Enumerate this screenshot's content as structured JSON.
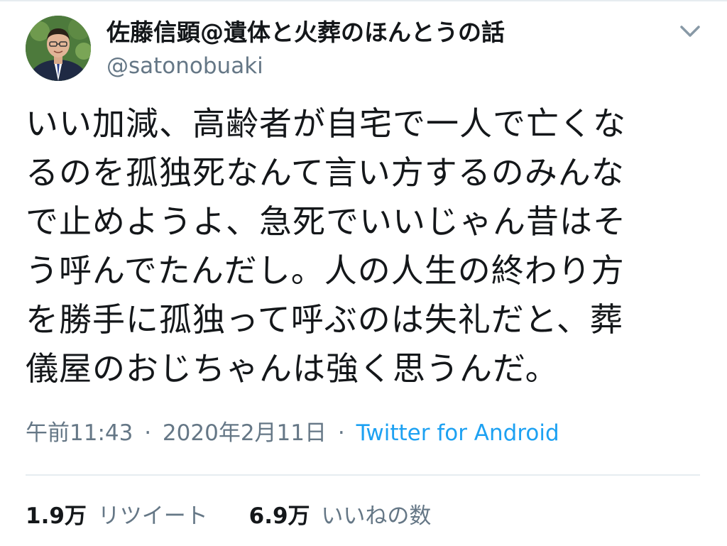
{
  "tweet": {
    "author": {
      "display_name": "佐藤信顕@遺体と火葬のほんとうの話",
      "handle": "@satonobuaki"
    },
    "text_lines": [
      "いい加減、高齢者が自宅で一人で亡くな",
      "るのを孤独死なんて言い方するのみんな",
      "で止めようよ、急死でいいじゃん昔はそ",
      "う呼んでたんだし。人の人生の終わり方",
      "を勝手に孤独って呼ぶのは失礼だと、葬",
      "儀屋のおじちゃんは強く思うんだ。"
    ],
    "time": "午前11:43",
    "separator": "·",
    "date": "2020年2月11日",
    "source": "Twitter for Android",
    "stats": {
      "retweets": {
        "count": "1.9万",
        "label": "リツイート"
      },
      "likes": {
        "count": "6.9万",
        "label": "いいねの数"
      }
    }
  },
  "icons": {
    "caret": "chevron-down-icon",
    "avatar": "profile-photo"
  },
  "colors": {
    "text_primary": "#14171a",
    "text_secondary": "#657786",
    "link": "#1da1f2",
    "divider": "#e6ecf0"
  }
}
